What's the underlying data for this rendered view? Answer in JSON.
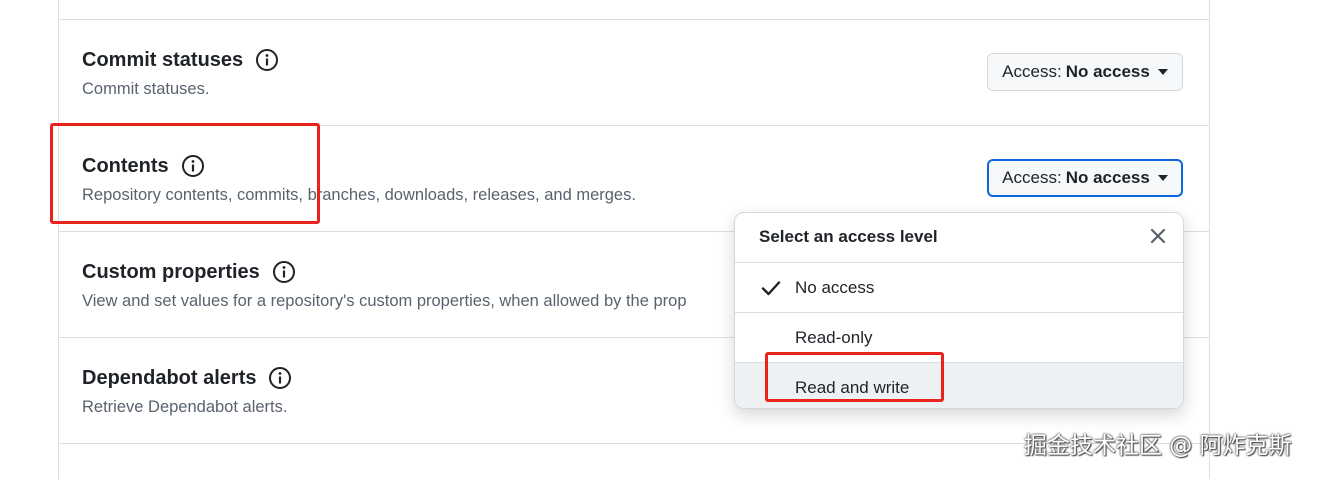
{
  "permissions": [
    {
      "title": "Commit statuses",
      "description": "Commit statuses.",
      "access_label": "Access:",
      "access_value": "No access"
    },
    {
      "title": "Contents",
      "description": "Repository contents, commits, branches, downloads, releases, and merges.",
      "access_label": "Access:",
      "access_value": "No access"
    },
    {
      "title": "Custom properties",
      "description": "View and set values for a repository's custom properties, when allowed by the prop"
    },
    {
      "title": "Dependabot alerts",
      "description": "Retrieve Dependabot alerts."
    }
  ],
  "dropdown": {
    "title": "Select an access level",
    "options": [
      {
        "label": "No access",
        "selected": true
      },
      {
        "label": "Read-only",
        "selected": false
      },
      {
        "label": "Read and write",
        "selected": false
      }
    ]
  },
  "watermark": "掘金技术社区 @ 阿炸克斯",
  "colors": {
    "annotation": "#e8231b",
    "focus": "#0969da"
  }
}
